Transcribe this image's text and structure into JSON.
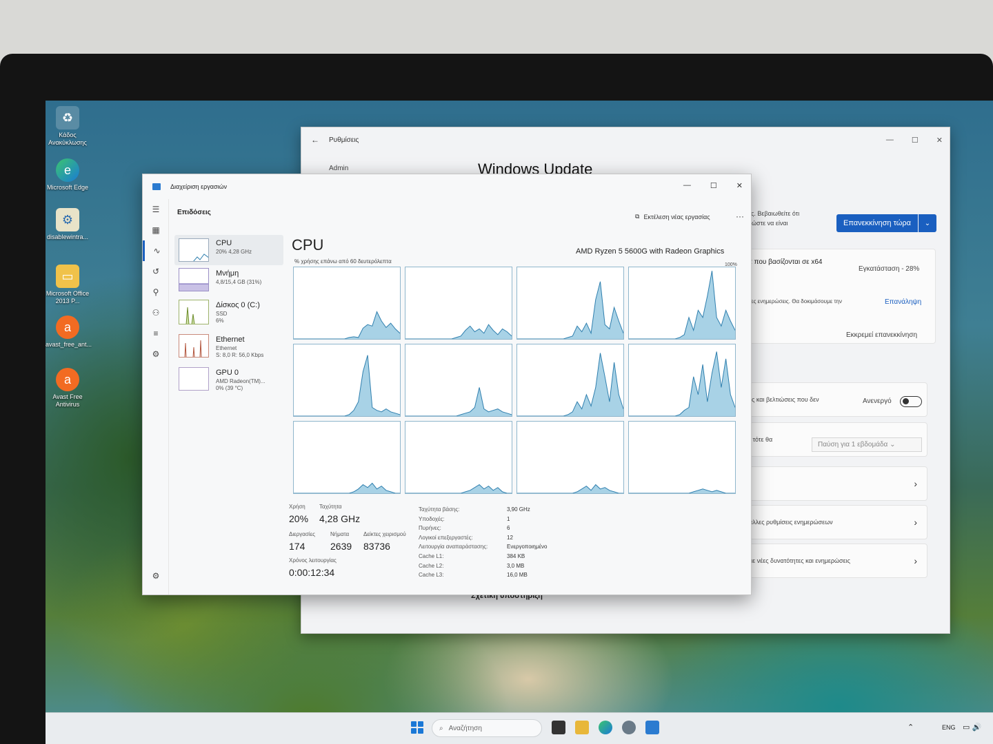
{
  "desktop": {
    "icons": [
      {
        "label": "Κάδος Ανακύκλωσης",
        "icon": "recycle-bin-icon"
      },
      {
        "label": "Microsoft Edge",
        "icon": "edge-icon"
      },
      {
        "label": "disablewintra...",
        "icon": "script-file-icon"
      },
      {
        "label": "Microsoft Office 2013 P...",
        "icon": "folder-icon"
      },
      {
        "label": "avast_free_ant...",
        "icon": "avast-installer-icon"
      },
      {
        "label": "Avast Free Antivirus",
        "icon": "avast-icon"
      }
    ]
  },
  "settings": {
    "title": "Ρυθμίσεις",
    "account": "Admin",
    "heading": "Windows Update",
    "restart_text": "ες. Βεβαιωθείτε ότι\n, ώστε να είναι",
    "restart_button": "Επανεκκίνηση τώρα",
    "update_title": "α που βασίζονται σε x64",
    "update_status": "Εγκατάσταση - 28%",
    "retry_text": "λες ενημερώσεις. Θα δοκιμάσουμε την",
    "retry_link": "Επανάληψη",
    "pending": "Εκκρεμεί επανεκκίνηση",
    "latest_text": "ες και βελτιώσεις που δεν",
    "latest_toggle": "Ανενεργό",
    "pause_text": "- τότε θα",
    "pause_select": "Παύση για 1 εβδομάδα",
    "advanced_text": "άλλες ρυθμίσεις ενημερώσεων",
    "insider_text": "με νέες δυνατότητες και ενημερώσεις",
    "support": "Σχετική υποστήριξη"
  },
  "taskmgr": {
    "title": "Διαχείριση εργασιών",
    "section": "Επιδόσεις",
    "run_task": "Εκτέλεση νέας εργασίας",
    "sidebar": [
      {
        "name": "CPU",
        "sub": [
          "20% 4,28 GHz"
        ]
      },
      {
        "name": "Μνήμη",
        "sub": [
          "4,8/15,4 GB (31%)"
        ]
      },
      {
        "name": "Δίσκος 0 (C:)",
        "sub": [
          "SSD",
          "6%"
        ]
      },
      {
        "name": "Ethernet",
        "sub": [
          "Ethernet",
          "S: 8,0 R: 56,0 Kbps"
        ]
      },
      {
        "name": "GPU 0",
        "sub": [
          "AMD Radeon(TM)...",
          "0% (39 °C)"
        ]
      }
    ],
    "cpu": {
      "title": "CPU",
      "model": "AMD Ryzen 5 5600G with Radeon Graphics",
      "axis_label": "% χρήσης επάνω από 60 δευτερόλεπτα",
      "axis_max": "100%",
      "cores": [
        [
          0,
          0,
          0,
          0,
          0,
          0,
          0,
          0,
          0,
          0,
          0,
          0,
          2,
          3,
          2,
          15,
          20,
          18,
          38,
          25,
          16,
          22,
          14,
          8
        ],
        [
          0,
          0,
          0,
          0,
          0,
          0,
          0,
          0,
          0,
          0,
          0,
          2,
          4,
          12,
          18,
          10,
          14,
          8,
          20,
          12,
          6,
          14,
          10,
          4
        ],
        [
          0,
          0,
          0,
          0,
          0,
          0,
          0,
          0,
          0,
          0,
          0,
          2,
          4,
          18,
          10,
          22,
          8,
          55,
          80,
          20,
          14,
          44,
          25,
          8
        ],
        [
          0,
          0,
          0,
          0,
          0,
          0,
          0,
          0,
          0,
          0,
          0,
          2,
          6,
          30,
          12,
          40,
          30,
          60,
          95,
          30,
          18,
          40,
          25,
          12
        ],
        [
          0,
          0,
          0,
          0,
          0,
          0,
          0,
          0,
          0,
          0,
          0,
          0,
          2,
          8,
          20,
          62,
          85,
          12,
          8,
          6,
          10,
          6,
          4,
          2
        ],
        [
          0,
          0,
          0,
          0,
          0,
          0,
          0,
          0,
          0,
          0,
          0,
          0,
          2,
          4,
          6,
          12,
          40,
          10,
          6,
          8,
          10,
          6,
          4,
          2
        ],
        [
          0,
          0,
          0,
          0,
          0,
          0,
          0,
          0,
          0,
          0,
          0,
          2,
          6,
          20,
          10,
          30,
          14,
          40,
          88,
          55,
          20,
          75,
          30,
          10
        ],
        [
          0,
          0,
          0,
          0,
          0,
          0,
          0,
          0,
          0,
          0,
          0,
          2,
          8,
          12,
          55,
          30,
          72,
          20,
          60,
          90,
          40,
          80,
          30,
          12
        ],
        [
          0,
          0,
          0,
          0,
          0,
          0,
          0,
          0,
          0,
          0,
          0,
          0,
          0,
          2,
          6,
          12,
          8,
          14,
          6,
          10,
          4,
          2,
          0,
          0
        ],
        [
          0,
          0,
          0,
          0,
          0,
          0,
          0,
          0,
          0,
          0,
          0,
          0,
          0,
          2,
          4,
          8,
          12,
          6,
          10,
          4,
          8,
          2,
          0,
          0
        ],
        [
          0,
          0,
          0,
          0,
          0,
          0,
          0,
          0,
          0,
          0,
          0,
          0,
          0,
          2,
          6,
          10,
          4,
          12,
          6,
          8,
          4,
          2,
          0,
          0
        ],
        [
          0,
          0,
          0,
          0,
          0,
          0,
          0,
          0,
          0,
          0,
          0,
          0,
          0,
          0,
          2,
          4,
          6,
          4,
          2,
          4,
          2,
          0,
          0,
          0
        ]
      ],
      "stats": {
        "usage_label": "Χρήση",
        "usage": "20%",
        "speed_label": "Ταχύτητα",
        "speed": "4,28 GHz",
        "procs_label": "Διεργασίες",
        "procs": "174",
        "threads_label": "Νήματα",
        "threads": "2639",
        "handles_label": "Δείκτες χειρισμού",
        "handles": "83736",
        "uptime_label": "Χρόνος λειτουργίας",
        "uptime": "0:00:12:34"
      },
      "details": [
        {
          "k": "Ταχύτητα βάσης:",
          "v": "3,90 GHz"
        },
        {
          "k": "Υποδοχές:",
          "v": "1"
        },
        {
          "k": "Πυρήνες:",
          "v": "6"
        },
        {
          "k": "Λογικοί επεξεργαστές:",
          "v": "12"
        },
        {
          "k": "Λειτουργία αναπαράστασης:",
          "v": "Ενεργοποιημένο"
        },
        {
          "k": "Cache L1:",
          "v": "384 KB"
        },
        {
          "k": "Cache L2:",
          "v": "3,0 MB"
        },
        {
          "k": "Cache L3:",
          "v": "16,0 MB"
        }
      ]
    }
  },
  "taskbar": {
    "search": "Αναζήτηση",
    "lang": "ENG"
  },
  "colors": {
    "accent": "#1a5fc0",
    "graph_fill": "#a8d2e6",
    "graph_line": "#2f7fae"
  }
}
